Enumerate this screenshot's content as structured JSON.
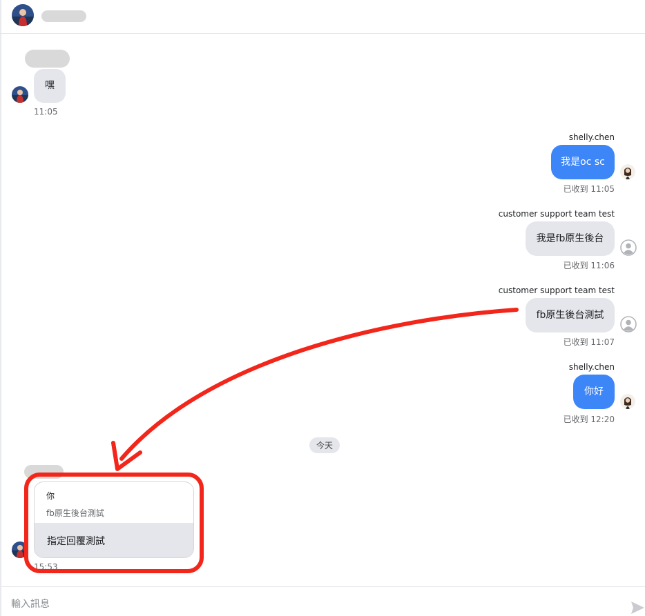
{
  "header": {
    "contact_name": ""
  },
  "messages": [
    {
      "direction": "in",
      "text": "嘿",
      "time": "11:05"
    },
    {
      "direction": "out",
      "sender": "shelly.chen",
      "text": "我是oc sc",
      "status": "已收到",
      "time": "11:05"
    },
    {
      "direction": "out",
      "sender": "customer support team test",
      "text": "我是fb原生後台",
      "status": "已收到",
      "time": "11:06"
    },
    {
      "direction": "out",
      "sender": "customer support team test",
      "text": "fb原生後台測試",
      "status": "已收到",
      "time": "11:07"
    },
    {
      "direction": "out",
      "sender": "shelly.chen",
      "text": "你好",
      "status": "已收到",
      "time": "12:20"
    }
  ],
  "date_divider": "今天",
  "reply_message": {
    "quoted_title": "你",
    "quoted_text": "fb原生後台測試",
    "text": "指定回覆測試",
    "time": "15:53"
  },
  "composer": {
    "placeholder": "輸入訊息"
  },
  "colors": {
    "outgoing_bubble": "#3d86f8",
    "incoming_bubble": "#e4e6eb",
    "annotation": "#f2261a"
  },
  "icons": [
    "profile-photo",
    "agent-photo",
    "user-placeholder-icon",
    "send-icon"
  ]
}
